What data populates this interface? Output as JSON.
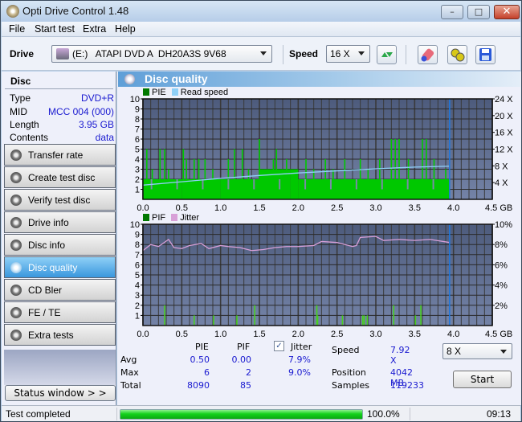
{
  "window": {
    "title": "Opti Drive Control 1.48",
    "controls": {
      "minimize": "–",
      "maximize": "□",
      "close": "✕"
    }
  },
  "menu": [
    "File",
    "Start test",
    "Extra",
    "Help"
  ],
  "toolbar": {
    "drive_label": "Drive",
    "drive_value": "(E:)   ATAPI DVD A  DH20A3S 9V68",
    "speed_label": "Speed",
    "speed_value": "16 X",
    "icons": [
      "refresh-icon",
      "eraser-icon",
      "settings-icon",
      "save-icon"
    ]
  },
  "disc": {
    "header": "Disc",
    "rows": [
      {
        "k": "Type",
        "v": "DVD+R"
      },
      {
        "k": "MID",
        "v": "MCC 004 (000)"
      },
      {
        "k": "Length",
        "v": "3.95 GB"
      },
      {
        "k": "Contents",
        "v": "data"
      }
    ]
  },
  "nav": [
    {
      "label": "Transfer rate",
      "active": false
    },
    {
      "label": "Create test disc",
      "active": false
    },
    {
      "label": "Verify test disc",
      "active": false
    },
    {
      "label": "Drive info",
      "active": false
    },
    {
      "label": "Disc info",
      "active": false
    },
    {
      "label": "Disc quality",
      "active": true
    },
    {
      "label": "CD Bler",
      "active": false
    },
    {
      "label": "FE / TE",
      "active": false
    },
    {
      "label": "Extra tests",
      "active": false
    }
  ],
  "status_window_label": "Status window > >",
  "panel_title": "Disc quality",
  "colors": {
    "pie": "#00c800",
    "pie_legend": "#007800",
    "read_speed": "#8fd0f8",
    "pif": "#48d020",
    "jitter": "#d8a0d8",
    "marker": "#1a78e0",
    "plot_bg_top": "#4d5b7c",
    "plot_bg_bottom": "#7483a7"
  },
  "chart_data": [
    {
      "type": "bar",
      "title": "PIE / Read speed",
      "legend": [
        "PIE",
        "Read speed"
      ],
      "legend_position": "top-left",
      "xlabel": "GB",
      "x_ticks": [
        "0.0",
        "0.5",
        "1.0",
        "1.5",
        "2.0",
        "2.5",
        "3.0",
        "3.5",
        "4.0",
        "4.5 GB"
      ],
      "xlim": [
        0,
        4.5
      ],
      "y_left_ticks": [
        "1",
        "2",
        "3",
        "4",
        "5",
        "6",
        "7",
        "8",
        "9",
        "10"
      ],
      "ylim_left": [
        0,
        10
      ],
      "y_right_ticks": [
        "4 X",
        "8 X",
        "12 X",
        "16 X",
        "20 X",
        "24 X"
      ],
      "ylim_right": [
        0,
        24
      ],
      "grid": true,
      "end_marker_gb": 3.95,
      "series": [
        {
          "name": "PIE",
          "type": "bar",
          "baseline": [
            [
              0,
              2
            ],
            [
              0.5,
              2
            ],
            [
              1.0,
              2
            ],
            [
              1.5,
              3
            ],
            [
              1.9,
              3
            ],
            [
              2.0,
              2
            ],
            [
              4.0,
              2
            ]
          ],
          "spikes": [
            [
              0.05,
              5
            ],
            [
              0.12,
              3
            ],
            [
              0.22,
              5
            ],
            [
              0.28,
              5
            ],
            [
              0.33,
              3
            ],
            [
              0.52,
              5
            ],
            [
              0.56,
              4
            ],
            [
              0.66,
              4
            ],
            [
              0.72,
              4
            ],
            [
              0.8,
              4
            ],
            [
              0.9,
              3
            ],
            [
              1.1,
              4
            ],
            [
              1.18,
              5
            ],
            [
              1.28,
              5
            ],
            [
              1.36,
              3
            ],
            [
              1.5,
              6
            ],
            [
              1.6,
              3
            ],
            [
              1.68,
              4
            ],
            [
              1.72,
              5
            ],
            [
              1.85,
              4
            ],
            [
              2.1,
              4
            ],
            [
              2.2,
              3
            ],
            [
              2.35,
              4
            ],
            [
              2.45,
              3
            ],
            [
              2.6,
              4
            ],
            [
              2.8,
              4
            ],
            [
              2.9,
              3
            ],
            [
              3.05,
              4
            ],
            [
              3.2,
              6
            ],
            [
              3.25,
              6
            ],
            [
              3.3,
              6
            ],
            [
              3.42,
              4
            ],
            [
              3.6,
              6
            ],
            [
              3.65,
              6
            ],
            [
              3.75,
              4
            ],
            [
              3.9,
              3
            ]
          ]
        },
        {
          "name": "Read speed",
          "type": "line",
          "unit": "X",
          "points": [
            [
              0,
              3.4
            ],
            [
              0.5,
              4.2
            ],
            [
              1.0,
              5.0
            ],
            [
              1.5,
              5.7
            ],
            [
              2.0,
              6.3
            ],
            [
              2.5,
              6.8
            ],
            [
              3.0,
              7.3
            ],
            [
              3.5,
              7.7
            ],
            [
              3.95,
              7.92
            ]
          ]
        }
      ]
    },
    {
      "type": "bar",
      "title": "PIF / Jitter",
      "legend": [
        "PIF",
        "Jitter"
      ],
      "legend_position": "top-left",
      "xlabel": "GB",
      "x_ticks": [
        "0.0",
        "0.5",
        "1.0",
        "1.5",
        "2.0",
        "2.5",
        "3.0",
        "3.5",
        "4.0",
        "4.5 GB"
      ],
      "xlim": [
        0,
        4.5
      ],
      "y_left_ticks": [
        "1",
        "2",
        "3",
        "4",
        "5",
        "6",
        "7",
        "8",
        "9",
        "10"
      ],
      "ylim_left": [
        0,
        10
      ],
      "y_right_ticks": [
        "2%",
        "4%",
        "6%",
        "8%",
        "10%"
      ],
      "ylim_right": [
        0,
        10
      ],
      "grid": true,
      "end_marker_gb": 3.95,
      "series": [
        {
          "name": "PIF",
          "type": "bar",
          "points": [
            [
              0.28,
              2
            ],
            [
              0.66,
              1
            ],
            [
              0.91,
              1
            ],
            [
              1.21,
              1
            ],
            [
              1.44,
              2
            ],
            [
              2.24,
              2
            ],
            [
              2.25,
              1
            ],
            [
              2.57,
              1
            ],
            [
              2.83,
              1
            ],
            [
              2.85,
              1
            ],
            [
              2.89,
              1
            ],
            [
              3.23,
              2
            ],
            [
              3.51,
              1
            ],
            [
              3.58,
              2
            ]
          ]
        },
        {
          "name": "Jitter",
          "type": "line",
          "unit": "%",
          "points": [
            [
              0,
              7.4
            ],
            [
              0.1,
              8.0
            ],
            [
              0.2,
              7.8
            ],
            [
              0.33,
              8.5
            ],
            [
              0.4,
              7.7
            ],
            [
              0.5,
              7.6
            ],
            [
              0.6,
              7.9
            ],
            [
              0.75,
              8.1
            ],
            [
              0.85,
              7.6
            ],
            [
              1.0,
              7.9
            ],
            [
              1.1,
              7.8
            ],
            [
              1.25,
              7.7
            ],
            [
              1.4,
              7.4
            ],
            [
              1.55,
              7.5
            ],
            [
              1.7,
              7.7
            ],
            [
              1.85,
              7.8
            ],
            [
              2.0,
              7.8
            ],
            [
              2.2,
              7.9
            ],
            [
              2.3,
              8.3
            ],
            [
              2.5,
              8.2
            ],
            [
              2.7,
              7.8
            ],
            [
              2.75,
              7.9
            ],
            [
              2.8,
              8.7
            ],
            [
              3.0,
              8.8
            ],
            [
              3.1,
              8.4
            ],
            [
              3.3,
              8.5
            ],
            [
              3.5,
              8.4
            ],
            [
              3.7,
              8.5
            ],
            [
              3.95,
              8.2
            ]
          ]
        }
      ]
    }
  ],
  "stats": {
    "col_pie": "PIE",
    "col_pif": "PIF",
    "col_jitter": "Jitter",
    "jitter_checked": true,
    "rows": [
      {
        "label": "Avg",
        "pie": "0.50",
        "pif": "0.00",
        "jitter": "7.9%"
      },
      {
        "label": "Max",
        "pie": "6",
        "pif": "2",
        "jitter": "9.0%"
      },
      {
        "label": "Total",
        "pie": "8090",
        "pif": "85",
        "jitter": ""
      }
    ],
    "speed_label": "Speed",
    "speed_value": "7.92 X",
    "position_label": "Position",
    "position_value": "4042 MB",
    "samples_label": "Samples",
    "samples_value": "119233",
    "speed_select": "8 X",
    "start_label": "Start"
  },
  "statusbar": {
    "text": "Test completed",
    "progress": 1.0,
    "progress_text": "100.0%",
    "time": "09:13"
  }
}
